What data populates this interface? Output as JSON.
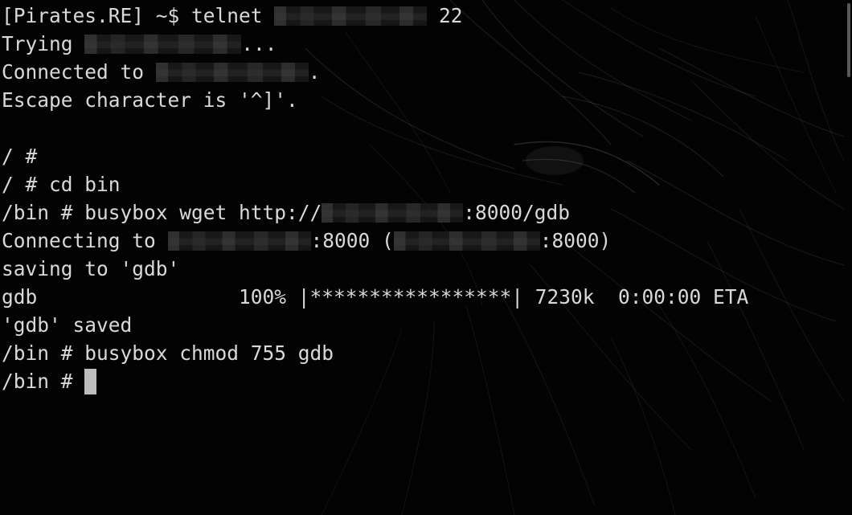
{
  "terminal": {
    "lines": {
      "l1": {
        "prompt": "[Pirates.RE] ~$ telnet ",
        "suffix": " 22"
      },
      "l2": {
        "prefix": "Trying ",
        "suffix": "..."
      },
      "l3": {
        "prefix": "Connected to ",
        "suffix": "."
      },
      "l4": {
        "text": "Escape character is '^]'."
      },
      "l5": {
        "text": ""
      },
      "l6": {
        "text": "/ #"
      },
      "l7": {
        "text": "/ # cd bin"
      },
      "l8": {
        "prefix": "/bin # busybox wget http://",
        "suffix": ":8000/gdb"
      },
      "l9": {
        "prefix": "Connecting to ",
        "middle": ":8000 (",
        "suffix": ":8000)"
      },
      "l10": {
        "text": "saving to 'gdb'"
      },
      "l11": {
        "text": "gdb                 100% |*****************| 7230k  0:00:00 ETA"
      },
      "l12": {
        "text": "'gdb' saved"
      },
      "l13": {
        "text": "/bin # busybox chmod 755 gdb"
      },
      "l14": {
        "prompt": "/bin # "
      }
    },
    "colors": {
      "background": "#030303",
      "foreground": "#d9d9d9",
      "cursor": "#bdbdbd"
    }
  }
}
